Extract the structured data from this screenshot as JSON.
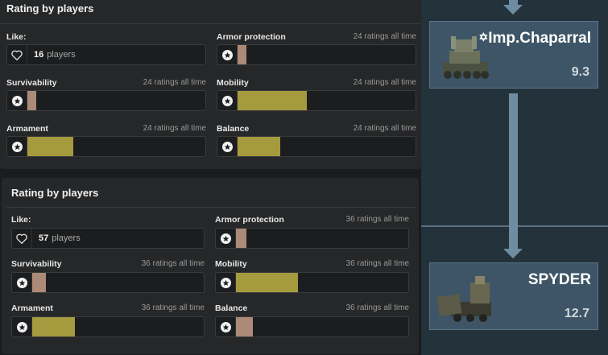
{
  "colors": {
    "tan": "#ab8a77",
    "olive": "#a59a3e"
  },
  "panels": [
    {
      "title": "Rating by players",
      "like": {
        "label": "Like:",
        "count": "16",
        "unit": "players"
      },
      "ratings": [
        {
          "label": "Armor protection",
          "meta": "24 ratings all time",
          "fill_fraction": 0.05,
          "color": "tan"
        },
        {
          "label": "Survivability",
          "meta": "24 ratings all time",
          "fill_fraction": 0.05,
          "color": "tan"
        },
        {
          "label": "Mobility",
          "meta": "24 ratings all time",
          "fill_fraction": 0.39,
          "color": "olive"
        },
        {
          "label": "Armament",
          "meta": "24 ratings all time",
          "fill_fraction": 0.26,
          "color": "olive"
        },
        {
          "label": "Balance",
          "meta": "24 ratings all time",
          "fill_fraction": 0.24,
          "color": "olive"
        }
      ]
    },
    {
      "title": "Rating by players",
      "like": {
        "label": "Like:",
        "count": "57",
        "unit": "players"
      },
      "ratings": [
        {
          "label": "Armor protection",
          "meta": "36 ratings all time",
          "fill_fraction": 0.06,
          "color": "tan"
        },
        {
          "label": "Survivability",
          "meta": "36 ratings all time",
          "fill_fraction": 0.08,
          "color": "tan"
        },
        {
          "label": "Mobility",
          "meta": "36 ratings all time",
          "fill_fraction": 0.36,
          "color": "olive"
        },
        {
          "label": "Armament",
          "meta": "36 ratings all time",
          "fill_fraction": 0.25,
          "color": "olive"
        },
        {
          "label": "Balance",
          "meta": "36 ratings all time",
          "fill_fraction": 0.1,
          "color": "tan"
        }
      ]
    }
  ],
  "tree": {
    "vehicles": [
      {
        "name": "Imp.Chaparral",
        "prefix_icon": "star-of-david-icon",
        "br": "9.3"
      },
      {
        "name": "SPYDER",
        "br": "12.7"
      }
    ]
  }
}
